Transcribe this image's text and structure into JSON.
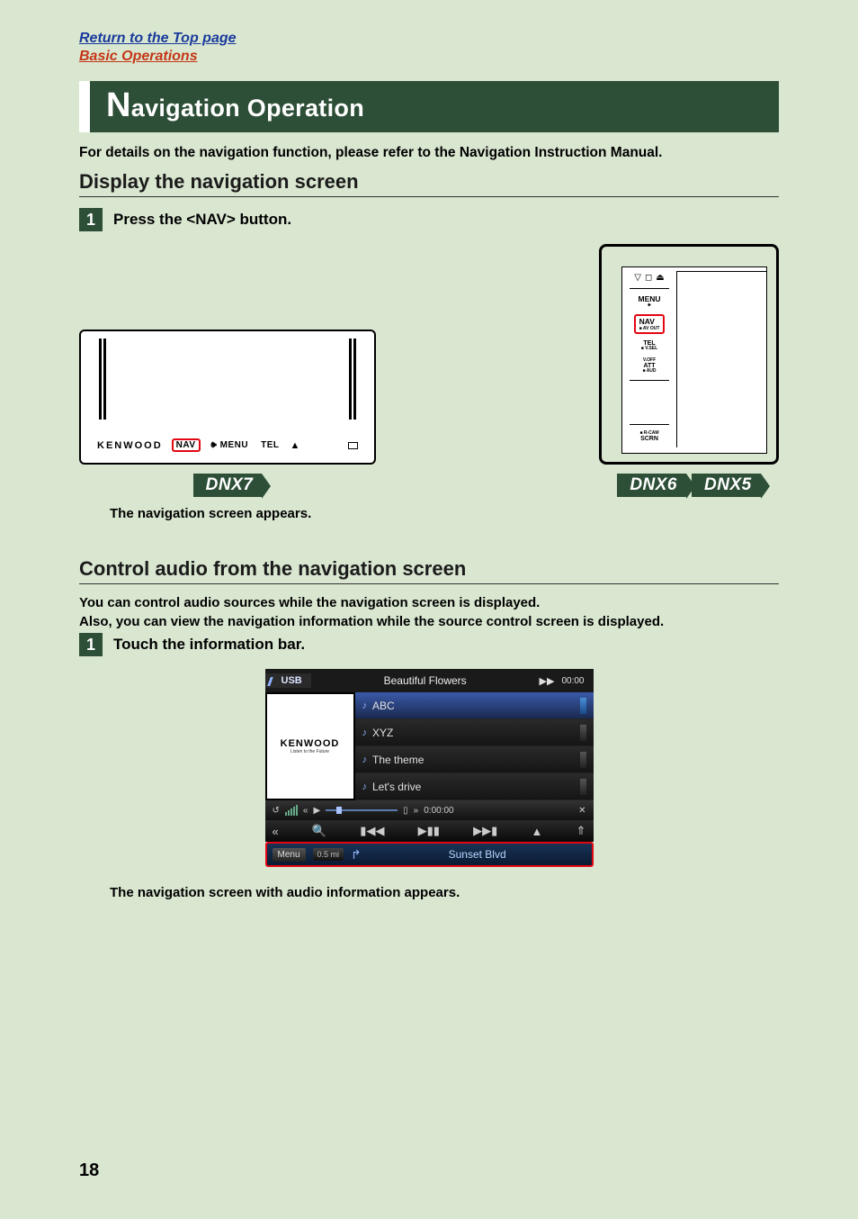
{
  "links": {
    "top": "Return to the Top page",
    "basic": "Basic Operations"
  },
  "title": {
    "prefix": "N",
    "rest": "avigation Operation"
  },
  "intro": "For details on the navigation function, please refer to the Navigation Instruction Manual.",
  "section1": {
    "heading": "Display the navigation screen",
    "step_num": "1",
    "step_text": "Press the <NAV> button.",
    "result": "The navigation screen appears."
  },
  "dnx7": {
    "logo": "KENWOOD",
    "nav_btn": "NAV",
    "menu_btn": "MENU",
    "tel_btn": "TEL",
    "eject": "▲",
    "badge": "DNX7"
  },
  "dnx65": {
    "menu": "MENU",
    "nav": "NAV",
    "nav_sub": "■ AV OUT",
    "tel": "TEL",
    "tel_sub": "■ V.SEL",
    "att": "ATT",
    "att_sub": "■ AUD",
    "rcam": "■ R-CAM",
    "scrn": "SCRN",
    "badge1": "DNX6",
    "badge2": "DNX5",
    "icons": {
      "tri": "▽",
      "sq": "◻",
      "ej": "⏏"
    }
  },
  "section2": {
    "heading": "Control audio from the navigation screen",
    "line1": "You can control audio sources while the navigation screen is displayed.",
    "line2": "Also, you can view the navigation information while the source control screen is displayed.",
    "step_num": "1",
    "step_text": "Touch the information bar.",
    "result": "The navigation screen with audio information appears."
  },
  "player": {
    "source": "USB",
    "song_title": "Beautiful Flowers",
    "ff": "▶▶",
    "clock": "00:00",
    "logo": "KENWOOD",
    "tagline": "Listen to the Future",
    "tracks": [
      "ABC",
      "XYZ",
      "The theme",
      "Let's drive"
    ],
    "loop": "↺",
    "pointer": "«",
    "play_icon": "▶",
    "pos_icon": "»",
    "pos_time": "0:00:00",
    "shuffle": "✕",
    "back_most": "«",
    "search": "🔍",
    "prev": "▮◀◀",
    "playpause": "▶▮▮",
    "next": "▶▶▮",
    "eject": "▲",
    "up": "⇑",
    "menu": "Menu",
    "distance": "0.5 mi",
    "arrow": "↱",
    "road": "Sunset Blvd"
  },
  "page_number": "18"
}
